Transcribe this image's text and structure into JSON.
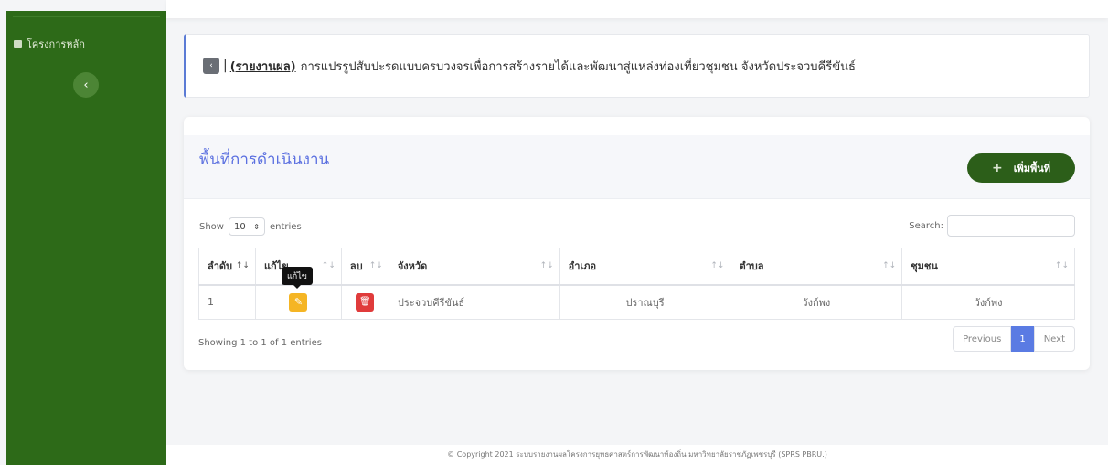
{
  "sidebar": {
    "menu_label": "โครงการหลัก",
    "collapse_icon": "‹"
  },
  "banner": {
    "back_icon": "‹",
    "separator": "|",
    "report_link": "(รายงานผล)",
    "title": "การแปรรูปสับปะรดแบบครบวงจรเพื่อการสร้างรายได้และพัฒนาสู่แหล่งท่องเที่ยวชุมชน จังหวัดประจวบคีรีขันธ์"
  },
  "card": {
    "heading": "พื้นที่การดำเนินงาน",
    "add_button": "เพิ่มพื้นที่",
    "add_icon": "+"
  },
  "datatable": {
    "show_label": "Show",
    "length_value": "10",
    "entries_label": "entries",
    "search_label": "Search:",
    "search_value": "",
    "columns": [
      "ลำดับ",
      "แก้ไข",
      "ลบ",
      "จังหวัด",
      "อำเภอ",
      "ตำบล",
      "ชุมชน"
    ],
    "rows": [
      {
        "no": "1",
        "province": "ประจวบคีรีขันธ์",
        "district": "ปราณบุรี",
        "subdistrict": "วังก์พง",
        "community": "วังก์พง"
      }
    ],
    "tooltip": "แก้ไข",
    "info": "Showing 1 to 1 of 1 entries",
    "pager": {
      "previous": "Previous",
      "current": "1",
      "next": "Next"
    }
  },
  "footer": {
    "text": "© Copyright 2021 ระบบรายงานผลโครงการยุทธศาสตร์การพัฒนาท้องถิ่น มหาวิทยาลัยราชภัฏเพชรบุรี (SPRS PBRU.)"
  },
  "colors": {
    "sidebar": "#2d6a18",
    "accent_blue": "#5a6fe0",
    "add_button": "#2c5e19",
    "edit": "#f5b524",
    "delete": "#e03b3b"
  }
}
